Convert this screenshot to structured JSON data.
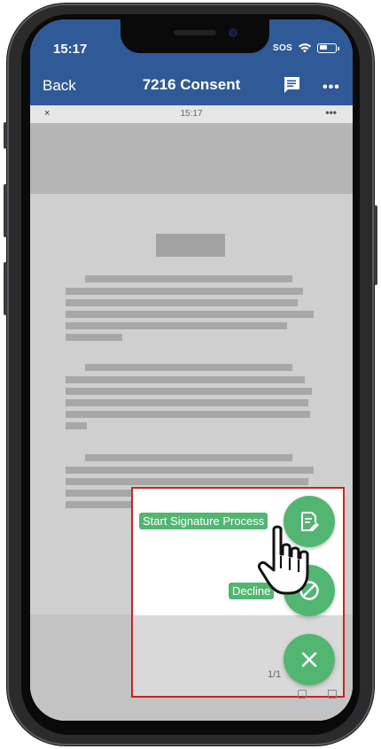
{
  "status_bar": {
    "time": "15:17",
    "sos_label": "SOS",
    "icons": [
      "wifi-icon",
      "battery-icon"
    ]
  },
  "nav": {
    "back_label": "Back",
    "title": "7216 Consent",
    "icons": [
      "message-icon",
      "more-icon"
    ],
    "more_label": "•••"
  },
  "viewer": {
    "close_label": "×",
    "time": "15:17",
    "more_label": "•••",
    "page_counter": "1/1"
  },
  "actions": {
    "start_signature_label": "Start Signature Process",
    "decline_label": "Decline",
    "icons": [
      "signature-edit-icon",
      "decline-icon",
      "close-icon",
      "hand-pointer-icon"
    ]
  },
  "colors": {
    "nav_blue": "#2f5a97",
    "fab_green": "#52b672",
    "highlight_red": "#cc2222"
  }
}
